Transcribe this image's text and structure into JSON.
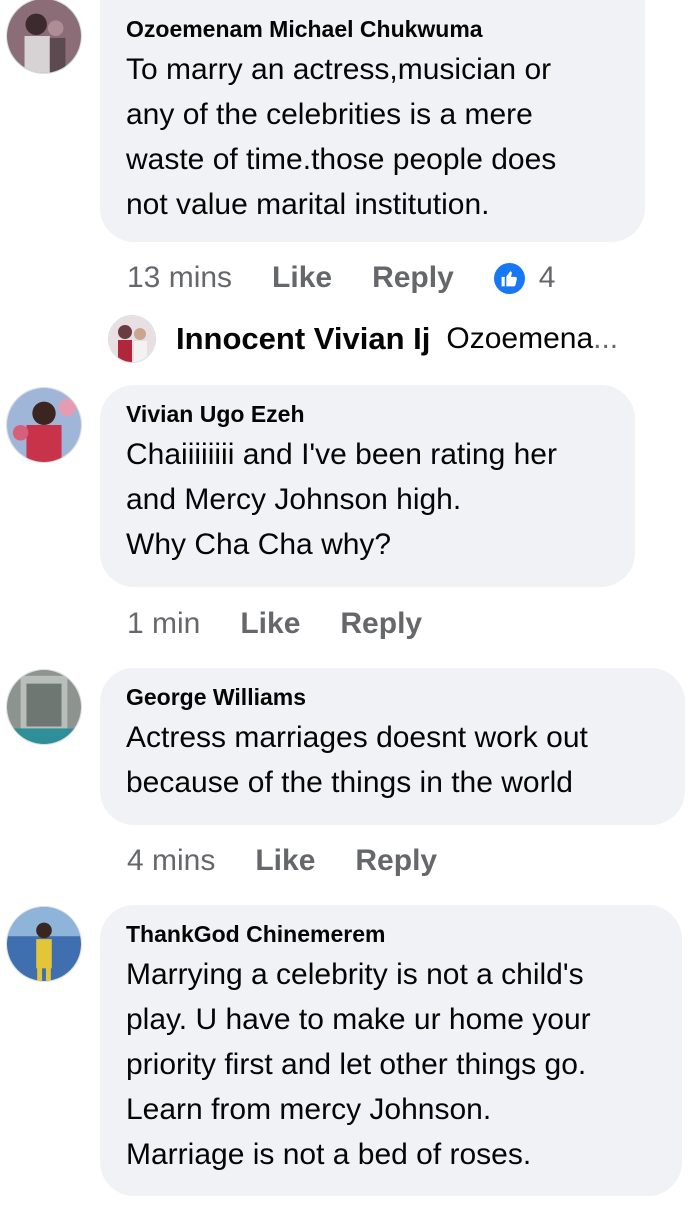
{
  "comments": [
    {
      "author": "Ozoemenam Michael Chukwuma",
      "text": "To marry an actress,musician or\nany of the celebrities is a mere\nwaste of time.those people does\nnot value marital institution.",
      "time": "13 mins",
      "like_label": "Like",
      "reply_label": "Reply",
      "reaction_count": "4",
      "avatar_icon": "profile-photo"
    },
    {
      "author": "Vivian Ugo Ezeh",
      "text": "Chaiiiiiiii and I've been rating her\nand Mercy Johnson high.\nWhy Cha Cha why?",
      "time": "1 min",
      "like_label": "Like",
      "reply_label": "Reply",
      "avatar_icon": "profile-photo"
    },
    {
      "author": "George Williams",
      "text": "Actress marriages doesnt work out\nbecause of the things in the world",
      "time": "4 mins",
      "like_label": "Like",
      "reply_label": "Reply",
      "avatar_icon": "profile-photo"
    },
    {
      "author": "ThankGod Chinemerem",
      "text": "Marrying a celebrity is not a child's\nplay. U have to make ur home your\npriority first and let other things go.\nLearn from mercy Johnson.\nMarriage is not a bed of roses.",
      "avatar_icon": "profile-photo"
    }
  ],
  "reply_preview": {
    "author": "Innocent Vivian Ij",
    "text": "Ozoemena",
    "ellipsis": "..."
  },
  "colors": {
    "bubble_bg": "#f0f2f5",
    "meta_text": "#65676b",
    "like_blue": "#1877f2"
  }
}
